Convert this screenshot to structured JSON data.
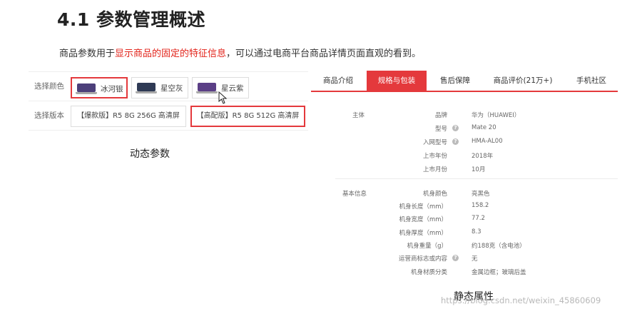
{
  "heading": "4.1 参数管理概述",
  "intro": {
    "before": "商品参数用于",
    "highlight": "显示商品的固定的特征信息",
    "after": "，可以通过电商平台商品详情页面直观的看到。"
  },
  "dynamic": {
    "color_label": "选择颜色",
    "colors": [
      {
        "name": "冰河银",
        "selected": true,
        "screen": "#4c3f7a"
      },
      {
        "name": "星空灰",
        "selected": false,
        "screen": "#2f3a55"
      },
      {
        "name": "星云紫",
        "selected": false,
        "screen": "#5b3f86"
      }
    ],
    "version_label": "选择版本",
    "versions": [
      {
        "name": "【爆款版】R5 8G 256G 高清屏",
        "selected": false
      },
      {
        "name": "【高配版】R5 8G 512G 高清屏",
        "selected": true
      }
    ],
    "caption": "动态参数"
  },
  "static": {
    "tabs": [
      {
        "label": "商品介绍",
        "active": false
      },
      {
        "label": "规格与包装",
        "active": true
      },
      {
        "label": "售后保障",
        "active": false
      },
      {
        "label": "商品评价(21万+)",
        "active": false
      },
      {
        "label": "手机社区",
        "active": false
      }
    ],
    "sections": [
      {
        "title": "主体",
        "rows": [
          {
            "key": "品牌",
            "value": "华为（HUAWEI）",
            "help": false
          },
          {
            "key": "型号",
            "value": "Mate 20",
            "help": true
          },
          {
            "key": "入网型号",
            "value": "HMA-AL00",
            "help": true
          },
          {
            "key": "上市年份",
            "value": "2018年",
            "help": false
          },
          {
            "key": "上市月份",
            "value": "10月",
            "help": false
          }
        ]
      },
      {
        "title": "基本信息",
        "rows": [
          {
            "key": "机身颜色",
            "value": "亮黑色",
            "help": false
          },
          {
            "key": "机身长度（mm）",
            "value": "158.2",
            "help": false
          },
          {
            "key": "机身宽度（mm）",
            "value": "77.2",
            "help": false
          },
          {
            "key": "机身厚度（mm）",
            "value": "8.3",
            "help": false
          },
          {
            "key": "机身重量（g）",
            "value": "约188克（含电池）",
            "help": false
          },
          {
            "key": "运营商标志或内容",
            "value": "无",
            "help": true
          },
          {
            "key": "机身材质分类",
            "value": "金属边框；玻璃后盖",
            "help": false
          }
        ]
      }
    ],
    "caption": "静态属性"
  },
  "watermark": "https://blog.csdn.net/weixin_45860609",
  "colors": {
    "accent": "#e4393c",
    "highlight": "#e2231a"
  }
}
